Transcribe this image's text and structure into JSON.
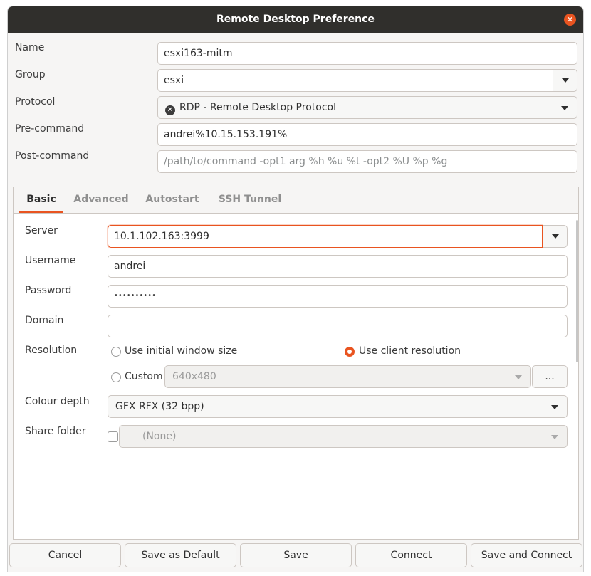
{
  "window": {
    "title": "Remote Desktop Preference",
    "close_glyph": "✕"
  },
  "header_form": {
    "name_label": "Name",
    "name_value": "esxi163-mitm",
    "group_label": "Group",
    "group_value": "esxi",
    "protocol_label": "Protocol",
    "protocol_value": "RDP - Remote Desktop Protocol",
    "precommand_label": "Pre-command",
    "precommand_value": "andrei%10.15.153.191%",
    "postcommand_label": "Post-command",
    "postcommand_placeholder": "/path/to/command -opt1 arg %h %u %t -opt2 %U %p %g"
  },
  "tabs": [
    {
      "label": "Basic",
      "active": true
    },
    {
      "label": "Advanced",
      "active": false
    },
    {
      "label": "Autostart",
      "active": false
    },
    {
      "label": "SSH Tunnel",
      "active": false
    }
  ],
  "basic": {
    "server_label": "Server",
    "server_value": "10.1.102.163:3999",
    "username_label": "Username",
    "username_value": "andrei",
    "password_label": "Password",
    "password_value": "••••••••••",
    "domain_label": "Domain",
    "domain_value": "",
    "resolution_label": "Resolution",
    "res_initial_label": "Use initial window size",
    "res_client_label": "Use client resolution",
    "res_custom_label": "Custom",
    "res_custom_value": "640x480",
    "res_custom_more": "...",
    "selected_resolution": "client",
    "colour_label": "Colour depth",
    "colour_value": "GFX RFX (32 bpp)",
    "share_label": "Share folder",
    "share_value": "(None)",
    "share_checked": false
  },
  "buttons": {
    "cancel": "Cancel",
    "save_default": "Save as Default",
    "save": "Save",
    "connect": "Connect",
    "save_connect": "Save and Connect"
  },
  "colors": {
    "accent": "#e95420",
    "titlebar": "#302f2c"
  }
}
